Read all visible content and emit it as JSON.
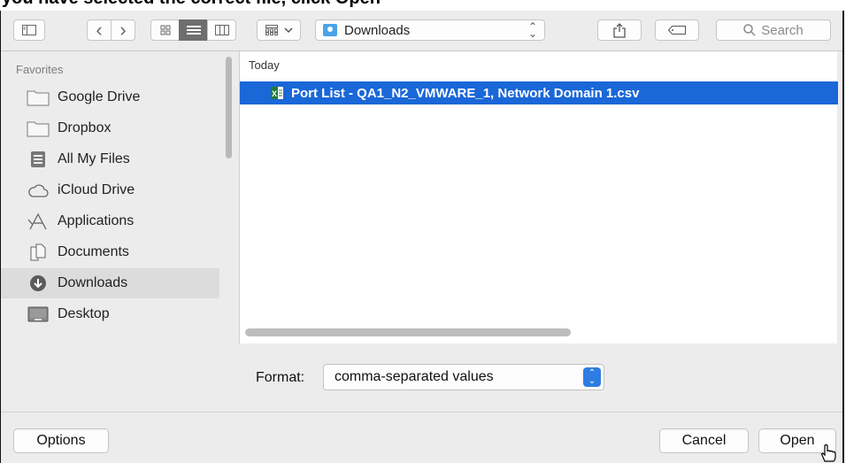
{
  "caption": {
    "text": "you have selected the correct file, click Open"
  },
  "toolbar": {
    "back_glyph": "‹",
    "forward_glyph": "›",
    "location": "Downloads",
    "search_placeholder": "Search"
  },
  "sidebar": {
    "title": "Favorites",
    "items": [
      {
        "label": "Google Drive",
        "icon": "folder-icon"
      },
      {
        "label": "Dropbox",
        "icon": "folder-icon"
      },
      {
        "label": "All My Files",
        "icon": "all-files-icon"
      },
      {
        "label": "iCloud Drive",
        "icon": "cloud-icon"
      },
      {
        "label": "Applications",
        "icon": "applications-icon"
      },
      {
        "label": "Documents",
        "icon": "documents-icon"
      },
      {
        "label": "Downloads",
        "icon": "downloads-icon",
        "selected": true
      },
      {
        "label": "Desktop",
        "icon": "desktop-icon"
      }
    ]
  },
  "filelist": {
    "group": "Today",
    "files": [
      {
        "name": "Port List - QA1_N2_VMWARE_1, Network Domain 1.csv",
        "icon": "excel-icon",
        "selected": true
      }
    ]
  },
  "format": {
    "label": "Format:",
    "value": "comma-separated values"
  },
  "buttons": {
    "options": "Options",
    "cancel": "Cancel",
    "open": "Open"
  },
  "colors": {
    "selection": "#1a67d8",
    "accent": "#2f7de2",
    "dialog_bg": "#ececec"
  }
}
